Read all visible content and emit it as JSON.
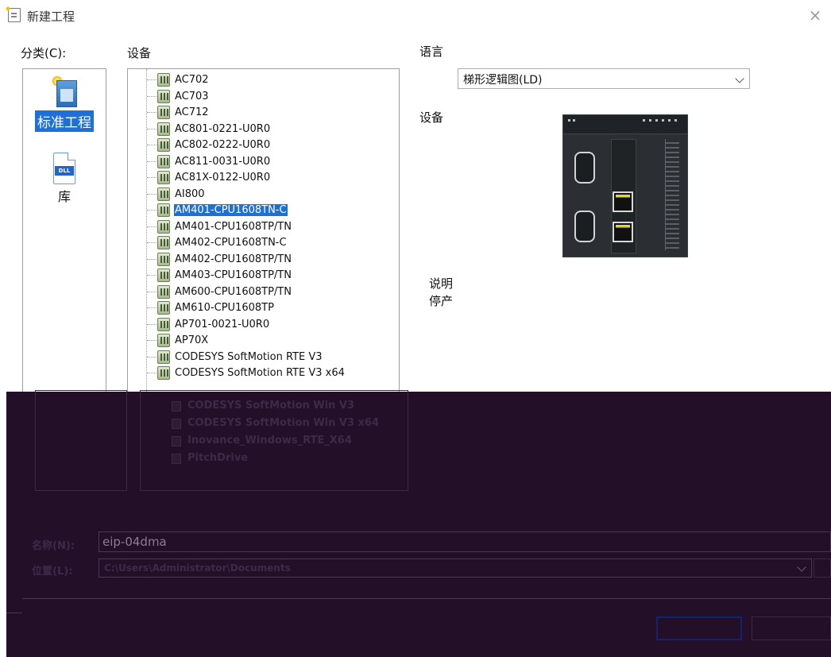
{
  "window": {
    "title": "新建工程",
    "close_glyph": "×"
  },
  "labels": {
    "category": "分类(C):",
    "devices": "设备",
    "language": "语言",
    "device_preview": "设备",
    "description": "说明",
    "description_value": "停产"
  },
  "categories": [
    {
      "label": "标准工程",
      "icon": "standard-project-icon",
      "selected": true
    },
    {
      "label": "库",
      "icon": "dll-library-icon",
      "selected": false,
      "icon_text": "DLL"
    }
  ],
  "devices": [
    "AC702",
    "AC703",
    "AC712",
    "AC801-0221-U0R0",
    "AC802-0222-U0R0",
    "AC811-0031-U0R0",
    "AC81X-0122-U0R0",
    "AI800",
    "AM401-CPU1608TN-C",
    "AM401-CPU1608TP/TN",
    "AM402-CPU1608TN-C",
    "AM402-CPU1608TP/TN",
    "AM403-CPU1608TP/TN",
    "AM600-CPU1608TP/TN",
    "AM610-CPU1608TP",
    "AP701-0021-U0R0",
    "AP70X",
    "CODESYS SoftMotion RTE V3",
    "CODESYS SoftMotion RTE V3 x64"
  ],
  "devices_dimmed": [
    "CODESYS SoftMotion Win V3",
    "CODESYS SoftMotion Win V3 x64",
    "Inovance_Windows_RTE_X64",
    "PitchDrive"
  ],
  "selected_device": "AM401-CPU1608TN-C",
  "language": {
    "value": "梯形逻辑图(LD)"
  },
  "form": {
    "name_label": "名称(N):",
    "name_value": "eip-04dma",
    "location_label": "位置(L):",
    "location_value": "C:\\Users\\Administrator\\Documents"
  },
  "colors": {
    "selection": "#1e6fd6",
    "overlay": "#230f28"
  }
}
